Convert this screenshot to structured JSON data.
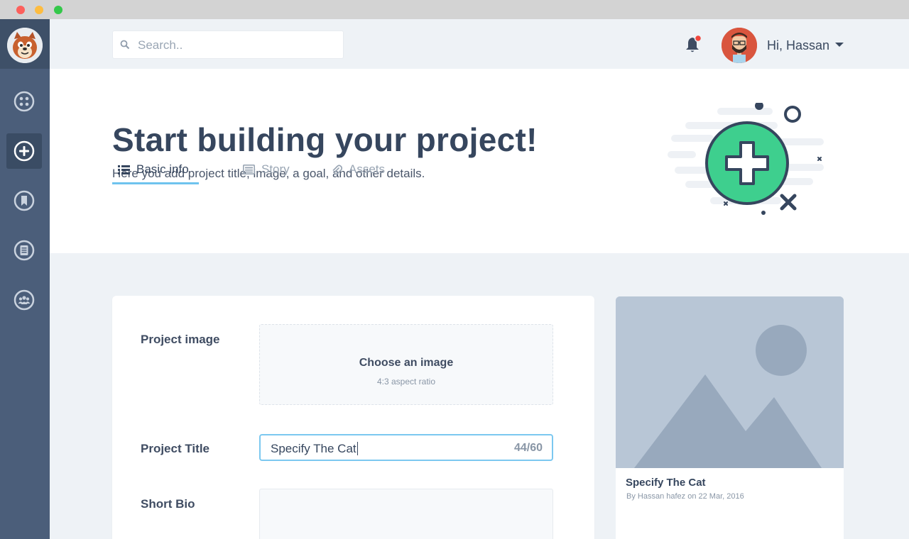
{
  "window": {
    "controls": [
      "close",
      "minimize",
      "maximize"
    ]
  },
  "sidebar": {
    "logo": "squirrel-logo",
    "items": [
      {
        "name": "dashboard",
        "icon": "grid-circle-icon",
        "active": false
      },
      {
        "name": "create-project",
        "icon": "plus-circle-icon",
        "active": true
      },
      {
        "name": "bookmarks",
        "icon": "bookmark-circle-icon",
        "active": false
      },
      {
        "name": "documents",
        "icon": "document-circle-icon",
        "active": false
      },
      {
        "name": "community",
        "icon": "users-circle-icon",
        "active": false
      }
    ]
  },
  "header": {
    "search_placeholder": "Search..",
    "notification_badge_color": "#f0463c",
    "greeting": "Hi, Hassan"
  },
  "hero": {
    "title": "Start building your project!",
    "subtitle": "Here you add project title, image, a goal, and other details."
  },
  "tabs": [
    {
      "label": "Basic info",
      "icon": "list-icon",
      "active": true
    },
    {
      "label": "Story",
      "icon": "newspaper-icon",
      "active": false
    },
    {
      "label": "Assets",
      "icon": "paperclip-icon",
      "active": false
    }
  ],
  "form": {
    "image_label": "Project image",
    "image_cta": "Choose an image",
    "image_hint": "4:3 aspect ratio",
    "title_label": "Project Title",
    "title_value": "Specify The Cat",
    "title_count": "44/60",
    "bio_label": "Short Bio"
  },
  "preview": {
    "title": "Specify The Cat",
    "meta": "By Hassan hafez on 22 Mar, 2016"
  },
  "colors": {
    "sidebar": "#4b5e7a",
    "accent_blue": "#6ec3ee",
    "accent_green": "#3ecf8e",
    "heading": "#36465e"
  }
}
